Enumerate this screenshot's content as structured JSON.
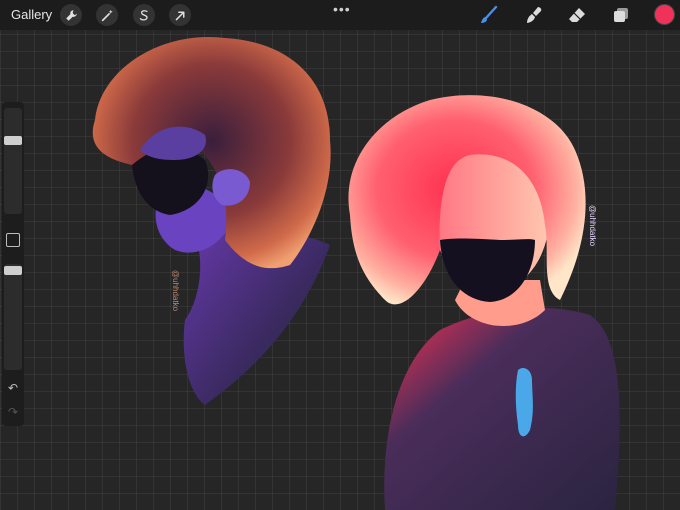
{
  "toolbar": {
    "gallery_label": "Gallery",
    "more_label": "•••",
    "left_tools": [
      "wrench-icon",
      "magic-wand-icon",
      "selection-icon",
      "transform-arrow-icon"
    ],
    "right_tools": [
      "brush-icon",
      "smudge-icon",
      "eraser-icon",
      "layers-icon"
    ],
    "brush_color": "#4a8fe8",
    "current_color": "#f0325a"
  },
  "sidebar": {
    "brush_size_level": 0.13,
    "opacity_level": 0.13,
    "undo_label": "↶",
    "redo_label": "↷"
  },
  "canvas": {
    "signature_left": "@uhhdatko",
    "signature_right": "@uhhdatko",
    "colors": {
      "left_figure_hair": "#b0503a",
      "left_figure_skin": "#5a3a9a",
      "right_figure_hair": "#ff4f6a",
      "right_figure_shirt": "#3b2c4f",
      "mask": "#151020"
    }
  }
}
